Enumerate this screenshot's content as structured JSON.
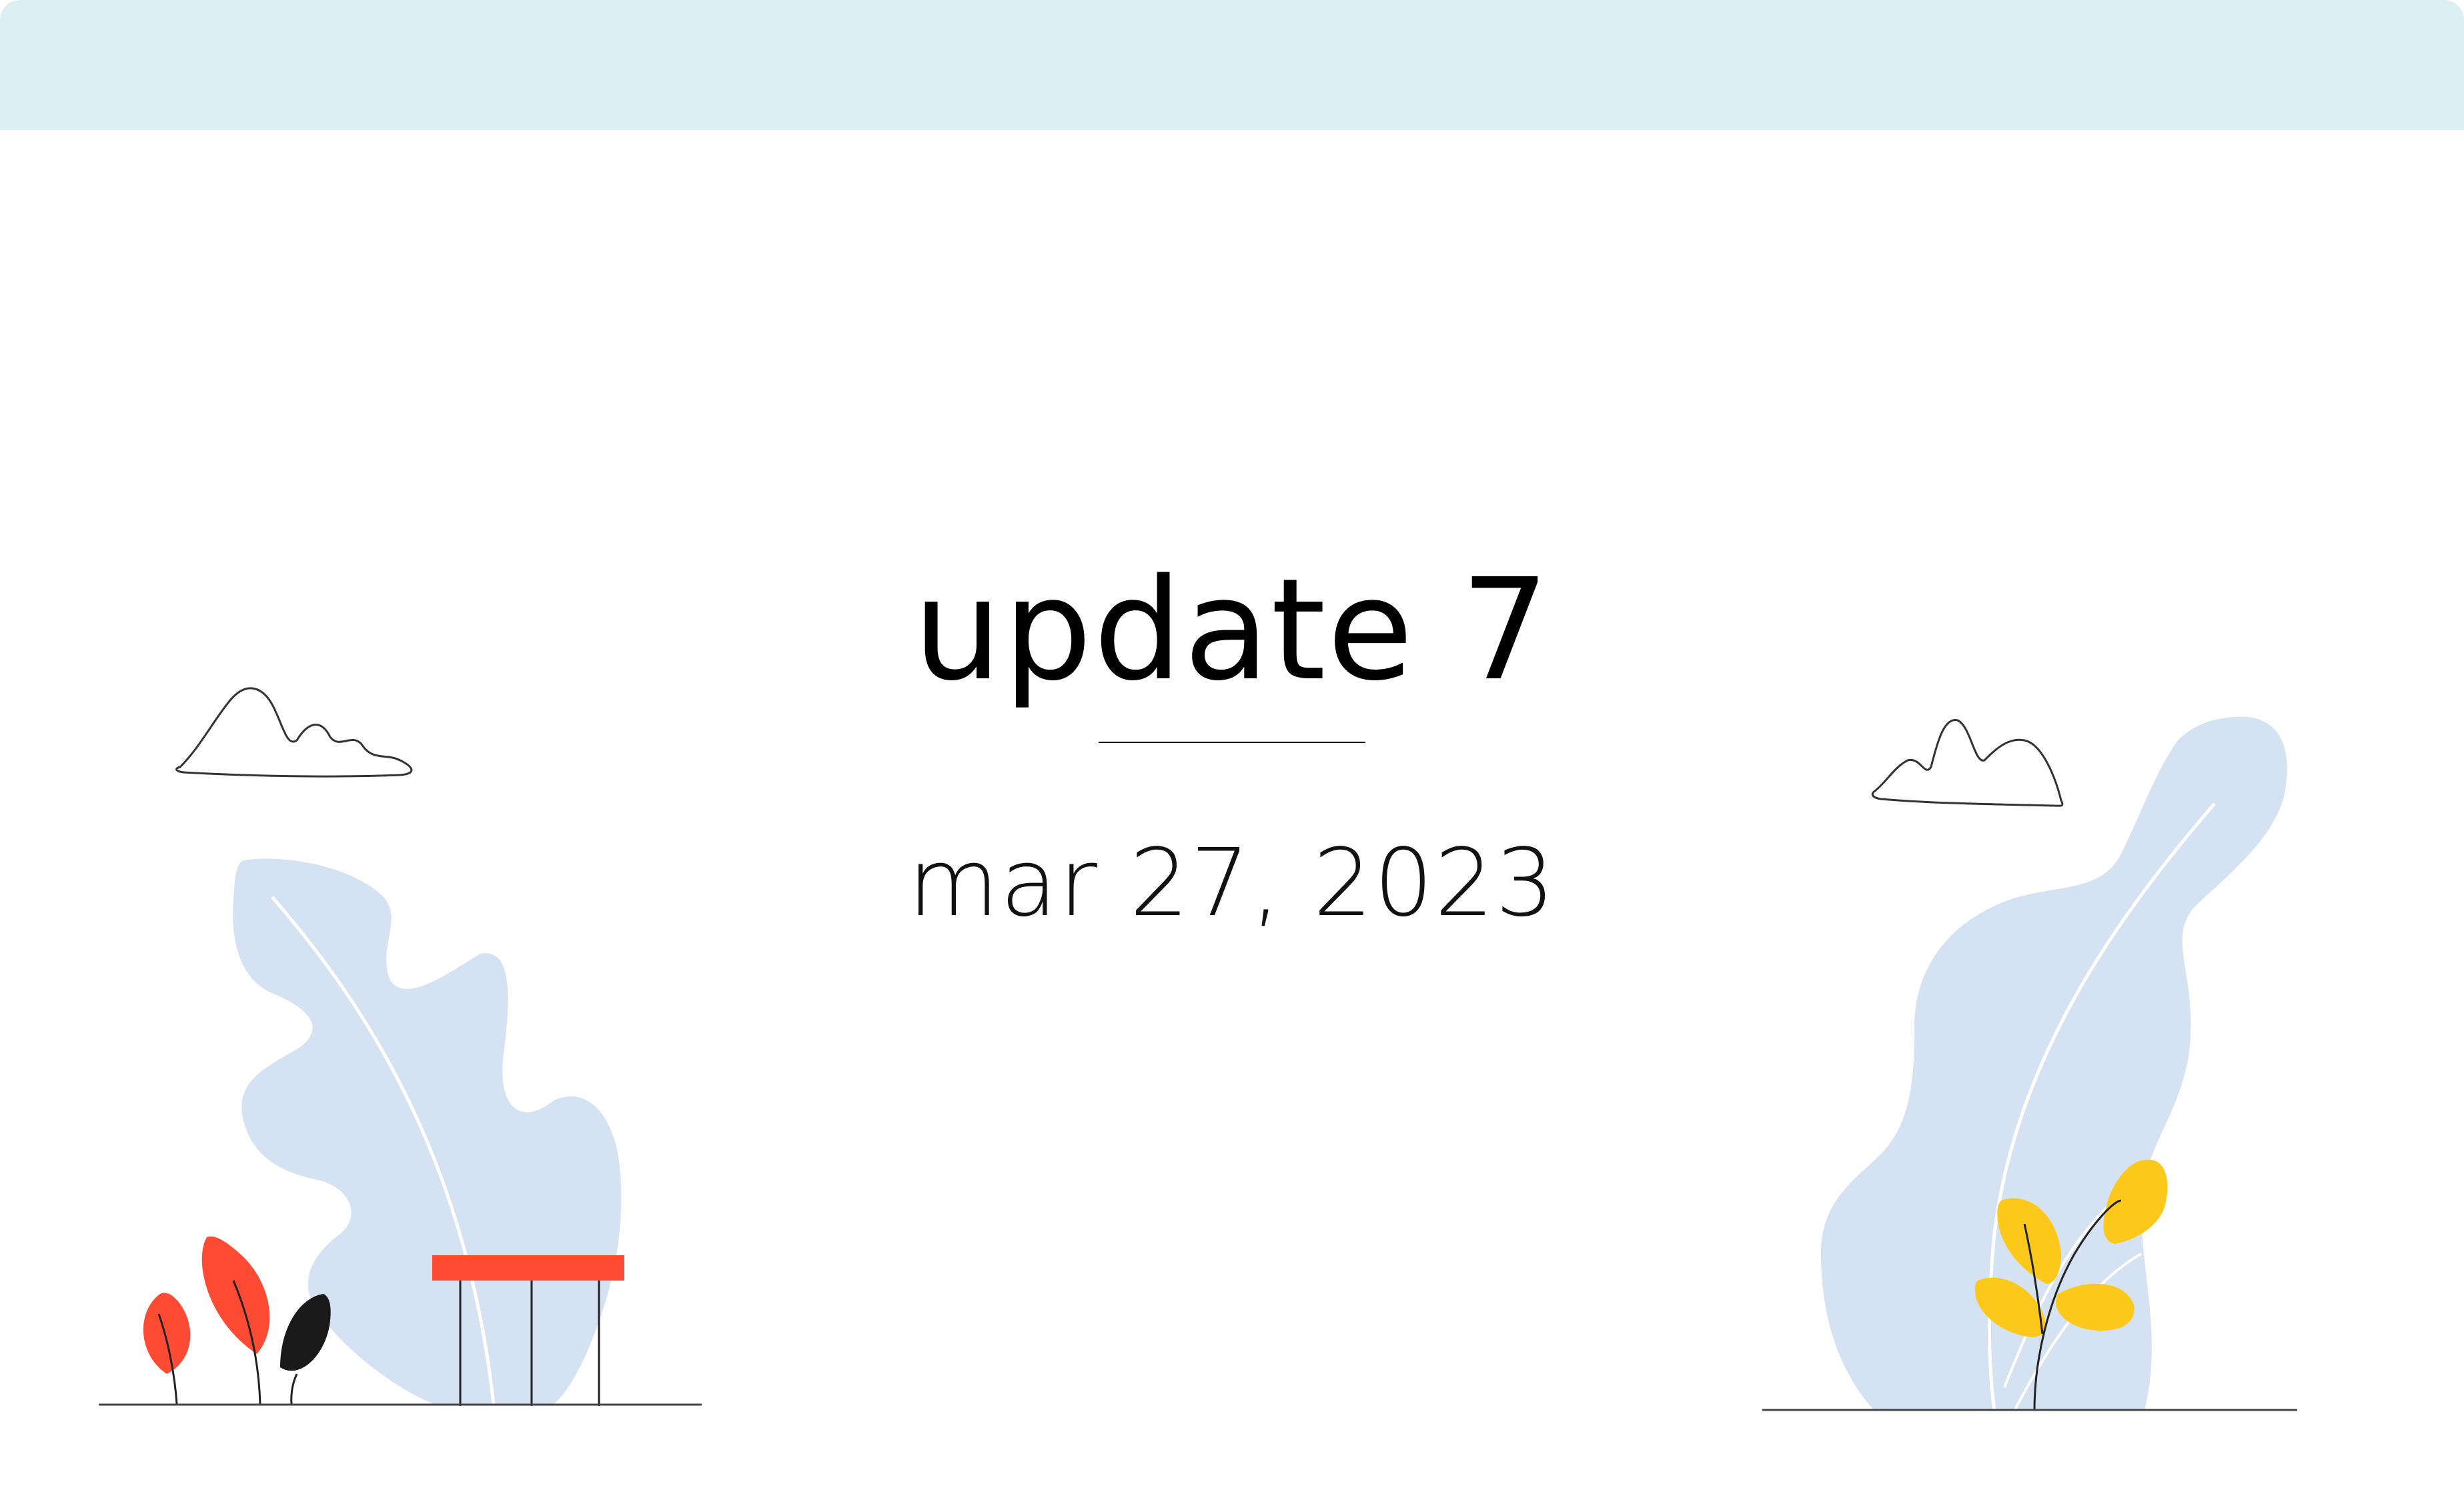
{
  "slide": {
    "title": "update 7",
    "date": "mar 27, 2023"
  },
  "colors": {
    "banner": "#dbeff2",
    "leaf_blue": "#d4e2f2",
    "accent_red": "#ff4b33",
    "accent_yellow": "#ffc91c",
    "dark": "#1a1a1a"
  },
  "icons": {
    "left_cloud": "cloud-outline-icon",
    "right_cloud": "cloud-outline-icon",
    "left_plants": "plant-illustration",
    "right_plants": "plant-illustration",
    "stool": "stool-illustration"
  }
}
